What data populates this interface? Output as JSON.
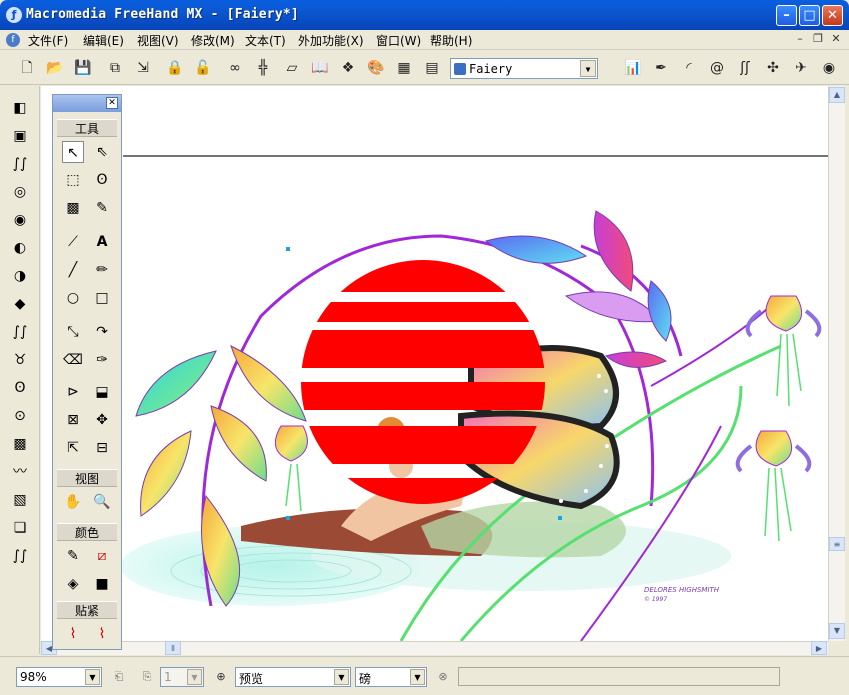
{
  "window": {
    "title": "Macromedia FreeHand MX - [Faiery*]",
    "controls": {
      "minimize": "–",
      "maximize": "□",
      "close": "✕"
    }
  },
  "menubar": {
    "items": [
      "文件(F)",
      "编辑(E)",
      "视图(V)",
      "修改(M)",
      "文本(T)",
      "外加功能(X)",
      "窗口(W)",
      "帮助(H)"
    ],
    "doc_controls": [
      "–",
      "❐",
      "✕"
    ]
  },
  "toolbar": {
    "left_icons": [
      "new-icon",
      "open-icon",
      "save-icon",
      "import-icon",
      "export-icon",
      "lock-icon",
      "unlock-icon",
      "link-icon",
      "align-icon",
      "transform-icon",
      "library-icon",
      "symbols-icon",
      "swatches-icon",
      "grid-icon",
      "layers-icon"
    ],
    "document_select": "Faiery",
    "right_icons": [
      "chart-icon",
      "eyedropper-icon",
      "arc-icon",
      "spiral-icon",
      "envelope-icon",
      "perspective-icon",
      "fisheye-icon",
      "about-icon"
    ]
  },
  "tools_panel": {
    "section_tools": "工具",
    "section_view": "视图",
    "section_color": "颜色",
    "section_snap": "贴紧"
  },
  "statusbar": {
    "zoom": "98%",
    "page": "1",
    "view_mode": "预览",
    "units": "磅"
  },
  "artwork": {
    "signature": "DELORES HIGHSMITH",
    "signature_year": "© 1997",
    "stripe_color": "#ff0000"
  }
}
